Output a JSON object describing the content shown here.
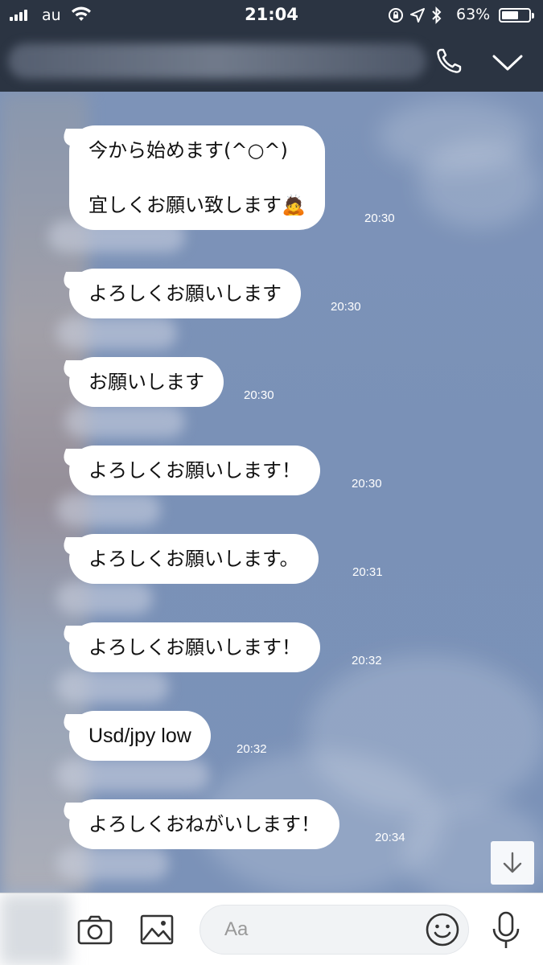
{
  "status_bar": {
    "carrier": "au",
    "time": "21:04",
    "battery_percent_label": "63%",
    "battery_level": 0.63,
    "icons": [
      "signal-icon",
      "wifi-icon",
      "orientation-lock-icon",
      "location-icon",
      "bluetooth-icon",
      "battery-icon"
    ]
  },
  "header": {
    "contact_name": "",
    "icons": [
      "phone-icon",
      "chevron-down-icon"
    ]
  },
  "messages": [
    {
      "text": "今から始めます(^○^)\n\n宜しくお願い致します🙇",
      "time": "20:30"
    },
    {
      "text": "よろしくお願いします",
      "time": "20:30"
    },
    {
      "text": "お願いします",
      "time": "20:30"
    },
    {
      "text": "よろしくお願いします！",
      "time": "20:30"
    },
    {
      "text": "よろしくお願いします。",
      "time": "20:31"
    },
    {
      "text": "よろしくお願いします！",
      "time": "20:32"
    },
    {
      "text": "Usd/jpy low",
      "time": "20:32"
    },
    {
      "text": "よろしくおねがいします！",
      "time": "20:34"
    }
  ],
  "input_bar": {
    "placeholder": "Aa",
    "icons": [
      "camera-icon",
      "image-icon",
      "emoji-icon",
      "microphone-icon"
    ]
  },
  "colors": {
    "chat_background": "#7b92b8",
    "header_background": "#2b3442",
    "bubble": "#ffffff"
  }
}
